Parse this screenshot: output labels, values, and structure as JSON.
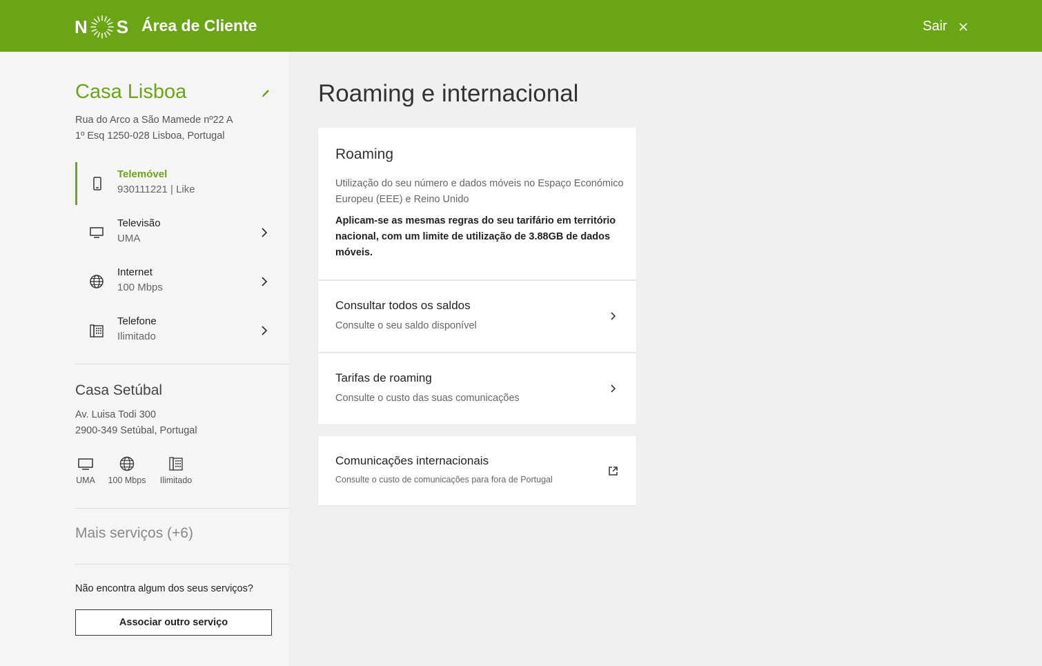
{
  "header": {
    "logo_left": "N",
    "logo_right": "S",
    "title": "Área de Cliente",
    "logout_label": "Sair"
  },
  "sidebar": {
    "primary_account": {
      "name": "Casa Lisboa",
      "address_line1": "Rua do Arco a São Mamede nº22 A",
      "address_line2": "1º Esq 1250-028 Lisboa, Portugal",
      "services": [
        {
          "name": "Telemóvel",
          "detail": "930111221 | Like",
          "icon": "mobile-icon",
          "active": true
        },
        {
          "name": "Televisão",
          "detail": "UMA",
          "icon": "tv-icon",
          "active": false
        },
        {
          "name": "Internet",
          "detail": "100 Mbps",
          "icon": "globe-icon",
          "active": false
        },
        {
          "name": "Telefone",
          "detail": "Ilimitado",
          "icon": "landline-phone-icon",
          "active": false
        }
      ]
    },
    "secondary_account": {
      "name": "Casa Setúbal",
      "address_line1": "Av. Luisa Todi 300",
      "address_line2": "2900-349 Setúbal, Portugal",
      "services": [
        {
          "label": "UMA",
          "icon": "tv-icon"
        },
        {
          "label": "100 Mbps",
          "icon": "globe-icon"
        },
        {
          "label": "Ilimitado",
          "icon": "landline-phone-icon"
        }
      ]
    },
    "more_services": "Mais serviços (+6)",
    "missing_question": "Não encontra algum dos seus serviços?",
    "associate_button": "Associar outro serviço"
  },
  "main": {
    "page_title": "Roaming e internacional",
    "roaming_card": {
      "title": "Roaming",
      "description": "Utilização do seu número e dados móveis no Espaço Económico Europeu (EEE) e Reino Unido",
      "highlight": "Aplicam-se as mesmas regras do seu tarifário em território nacional, com um limite de utilização de 3.88GB de dados móveis."
    },
    "links": [
      {
        "title": "Consultar todos os saldos",
        "subtitle": "Consulte o seu saldo disponível"
      },
      {
        "title": "Tarifas de roaming",
        "subtitle": "Consulte o custo das suas comunicações"
      }
    ],
    "international": {
      "title": "Comunicações internacionais",
      "subtitle": "Consulte o custo de comunicações para fora de Portugal"
    }
  },
  "colors": {
    "brand_green": "#6aa516",
    "background": "#f0f0f1",
    "sidebar_bg": "#f5f5f5"
  }
}
